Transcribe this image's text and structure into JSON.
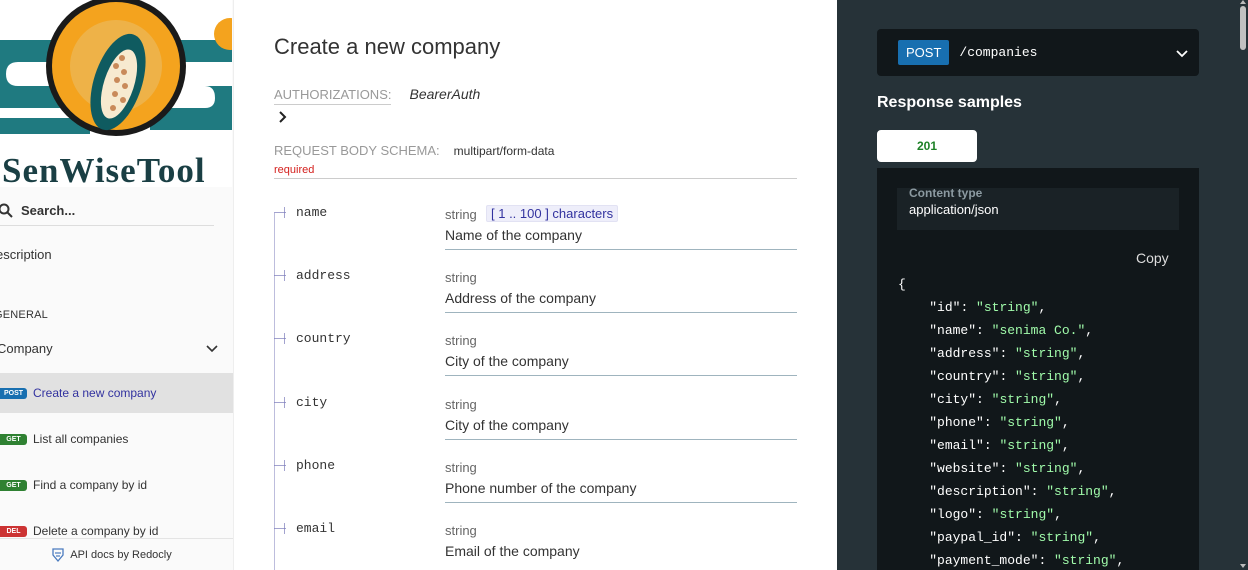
{
  "sidebar": {
    "logo_text": "SenWiseTool",
    "search_placeholder": "Search...",
    "description_link": "escription",
    "section_label": "GENERAL",
    "group_label": "Company",
    "operations": [
      {
        "method": "POST",
        "label": "Create a new company",
        "active": true
      },
      {
        "method": "GET",
        "label": "List all companies"
      },
      {
        "method": "GET",
        "label": "Find a company by id"
      },
      {
        "method": "DEL",
        "label": "Delete a company by id"
      }
    ],
    "footer": "API docs by Redocly"
  },
  "main": {
    "title": "Create a new company",
    "authorizations_label": "AUTHORIZATIONS:",
    "authorizations_value": "BearerAuth",
    "schema_label": "REQUEST BODY SCHEMA:",
    "schema_value": "multipart/form-data",
    "required_label": "required",
    "properties": [
      {
        "name": "name",
        "type": "string",
        "constraint": "[ 1 .. 100 ] characters",
        "description": "Name of the company"
      },
      {
        "name": "address",
        "type": "string",
        "constraint": "",
        "description": "Address of the company"
      },
      {
        "name": "country",
        "type": "string",
        "constraint": "",
        "description": "City of the company"
      },
      {
        "name": "city",
        "type": "string",
        "constraint": "",
        "description": "City of the company"
      },
      {
        "name": "phone",
        "type": "string",
        "constraint": "",
        "description": "Phone number of the company"
      },
      {
        "name": "email",
        "type": "string",
        "constraint": "",
        "description": "Email of the company"
      }
    ]
  },
  "right": {
    "method": "POST",
    "path": "/companies",
    "response_title": "Response samples",
    "status_tab": "201",
    "content_type_label": "Content type",
    "content_type_value": "application/json",
    "copy_label": "Copy",
    "json_open": "{",
    "json_fields": [
      {
        "key": "\"id\"",
        "value": "\"string\""
      },
      {
        "key": "\"name\"",
        "value": "\"senima Co.\""
      },
      {
        "key": "\"address\"",
        "value": "\"string\""
      },
      {
        "key": "\"country\"",
        "value": "\"string\""
      },
      {
        "key": "\"city\"",
        "value": "\"string\""
      },
      {
        "key": "\"phone\"",
        "value": "\"string\""
      },
      {
        "key": "\"email\"",
        "value": "\"string\""
      },
      {
        "key": "\"website\"",
        "value": "\"string\""
      },
      {
        "key": "\"description\"",
        "value": "\"string\""
      },
      {
        "key": "\"logo\"",
        "value": "\"string\""
      },
      {
        "key": "\"paypal_id\"",
        "value": "\"string\""
      },
      {
        "key": "\"payment_mode\"",
        "value": "\"string\""
      }
    ]
  },
  "colors": {
    "post": "#186fb0",
    "get": "#2f8132",
    "delete": "#cc3333",
    "right_panel_bg": "#263238",
    "json_string": "#a0fbaa",
    "status_201": "#1d8127"
  }
}
